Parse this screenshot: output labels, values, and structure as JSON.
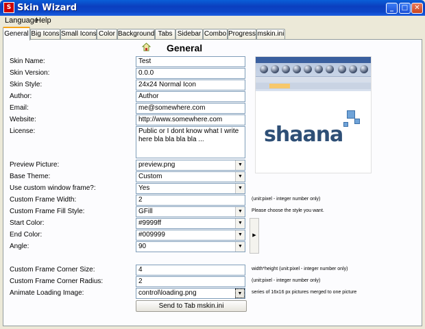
{
  "window": {
    "title": "Skin Wizard",
    "icon_letter": "S",
    "buttons": [
      "_",
      "□",
      "✕"
    ]
  },
  "menu": [
    "Language",
    "Help"
  ],
  "tabs": [
    "General",
    "Big Icons",
    "Small Icons",
    "Color",
    "Background",
    "Tabs",
    "Sidebar",
    "Combo",
    "Progress",
    "mskin.ini"
  ],
  "active_tab": "General",
  "section_title": "General",
  "fields": {
    "skin_name": {
      "label": "Skin Name:",
      "value": "Test"
    },
    "skin_version": {
      "label": "Skin Version:",
      "value": "0.0.0"
    },
    "skin_style": {
      "label": "Skin Style:",
      "value": "24x24 Normal Icon"
    },
    "author": {
      "label": "Author:",
      "value": "Author"
    },
    "email": {
      "label": "Email:",
      "value": "me@somewhere.com"
    },
    "website": {
      "label": "Website:",
      "value": "http://www.somewhere.com"
    },
    "license": {
      "label": "License:",
      "value": "Public or I dont know what I write here bla bla bla bla ..."
    },
    "preview_picture": {
      "label": "Preview Picture:",
      "value": "preview.png"
    },
    "base_theme": {
      "label": "Base Theme:",
      "value": "Custom"
    },
    "custom_window_frame": {
      "label": "Use custom window frame?:",
      "value": "Yes"
    },
    "frame_width": {
      "label": "Custom Frame Width:",
      "value": "2",
      "hint": "(unit:pixel - integer number only)"
    },
    "frame_fill_style": {
      "label": "Custom Frame Fill Style:",
      "value": "GFill",
      "hint": "Please choose the style you want."
    },
    "start_color": {
      "label": "Start Color:",
      "value": "#9999ff"
    },
    "end_color": {
      "label": "End Color:",
      "value": "#009999"
    },
    "angle": {
      "label": "Angle:",
      "value": "90"
    },
    "corner_size": {
      "label": "Custom Frame Corner Size:",
      "value": "4",
      "hint": "width*height (unit:pixel - integer number only)"
    },
    "corner_radius": {
      "label": "Custom Frame Corner Radius:",
      "value": "2",
      "hint": "(unit:pixel - integer number only)"
    },
    "loading_image": {
      "label": "Animate Loading Image:",
      "value": "control\\loading.png",
      "hint": "series of 16x16 px pictures merged to one picture"
    }
  },
  "send_button": "Send to Tab mskin.ini",
  "preview": {
    "logo_text": "shaana"
  },
  "icons": {
    "home": "home-icon",
    "combo_arrow": "▼",
    "side_arrow": "▶"
  }
}
